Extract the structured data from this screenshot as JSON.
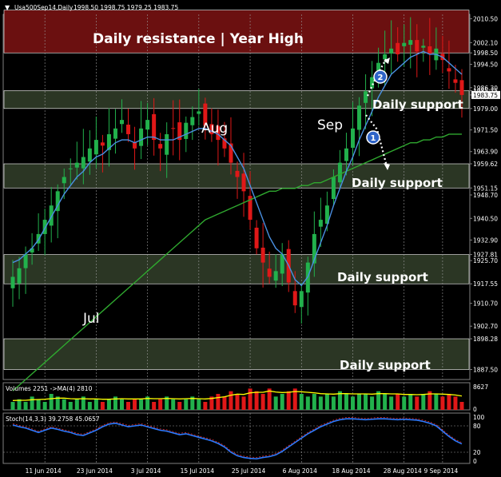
{
  "header": {
    "symbol": "Usa500Sep14,Daily",
    "ohlc": "1998.50 1998.75 1979.25 1983.75"
  },
  "colors": {
    "background": "#000000",
    "up_candle": "#22b14c",
    "down_candle": "#e01818",
    "ma_fast": "#4a90e2",
    "ma_slow": "#2fa82f",
    "resistance_zone": "#6b1010",
    "support_zone": "#33402a",
    "axis_text": "#ffffff",
    "stoch_line": "#2e7bff",
    "volume_ma": "#ffff00"
  },
  "annotations": {
    "resistance": "Daily resistance | Year High",
    "support_1": "Daily support",
    "support_2": "Daily support",
    "support_3": "Daily support",
    "support_4": "Daily support",
    "month_jul": "Jul",
    "month_aug": "Aug",
    "month_sep": "Sep",
    "marker_1": "1",
    "marker_2": "2"
  },
  "volume_panel": {
    "label": "Volumes 2251 ->MA(4) 2810",
    "max_label": "8627",
    "min_label": "0"
  },
  "stoch_panel": {
    "label": "Stoch(14,3,3) 39.2758 45.0657",
    "ticks": [
      "100",
      "80",
      "20",
      "0"
    ]
  },
  "chart_data": {
    "type": "candlestick",
    "y_axis_labels": [
      "2010.50",
      "2002.10",
      "1998.50",
      "1994.50",
      "1986.30",
      "1985.25",
      "1983.75",
      "1979.00",
      "1971.50",
      "1963.90",
      "1959.62",
      "1951.15",
      "1948.70",
      "1940.50",
      "1932.90",
      "1927.81",
      "1925.70",
      "1917.55",
      "1910.70",
      "1902.70",
      "1898.28",
      "1887.50"
    ],
    "ylim": [
      1884,
      2012
    ],
    "x_axis_labels": [
      "11 Jun 2014",
      "23 Jun 2014",
      "3 Jul 2014",
      "15 Jul 2014",
      "25 Jul 2014",
      "6 Aug 2014",
      "18 Aug 2014",
      "28 Aug 2014",
      "9 Sep 2014"
    ],
    "resistance_zone": [
      1998.5,
      2010.5
    ],
    "support_zones": [
      [
        1979.0,
        1985.25
      ],
      [
        1951.15,
        1959.62
      ],
      [
        1917.55,
        1927.81
      ],
      [
        1887.5,
        1898.28
      ]
    ],
    "close_series": [
      1920,
      1923,
      1928,
      1930,
      1935,
      1940,
      1945,
      1950,
      1955,
      1958,
      1960,
      1962,
      1965,
      1968,
      1966,
      1970,
      1972,
      1975,
      1970,
      1965,
      1972,
      1975,
      1968,
      1965,
      1970,
      1972,
      1968,
      1974,
      1976,
      1978,
      1973,
      1970,
      1968,
      1965,
      1960,
      1955,
      1950,
      1940,
      1930,
      1925,
      1920,
      1922,
      1928,
      1918,
      1910,
      1915,
      1925,
      1935,
      1940,
      1945,
      1955,
      1960,
      1965,
      1972,
      1980,
      1985,
      1990,
      1995,
      1998,
      2000,
      1998,
      2002,
      2003,
      1999,
      2001,
      1998,
      2000,
      1996,
      1992,
      1988,
      1983.75
    ],
    "ma_fast": [
      1925,
      1926,
      1928,
      1930,
      1933,
      1937,
      1941,
      1945,
      1949,
      1952,
      1955,
      1957,
      1960,
      1962,
      1963,
      1965,
      1967,
      1968,
      1968,
      1967,
      1968,
      1969,
      1969,
      1968,
      1968,
      1968,
      1969,
      1970,
      1971,
      1972,
      1972,
      1971,
      1970,
      1968,
      1966,
      1962,
      1958,
      1952,
      1946,
      1940,
      1934,
      1930,
      1928,
      1924,
      1919,
      1917,
      1920,
      1926,
      1932,
      1938,
      1945,
      1951,
      1957,
      1962,
      1968,
      1973,
      1978,
      1983,
      1987,
      1991,
      1993,
      1995,
      1997,
      1998,
      1999,
      1998,
      1998,
      1997,
      1995,
      1993,
      1991
    ],
    "ma_slow": [
      1880,
      1882,
      1884,
      1886,
      1888,
      1890,
      1892,
      1894,
      1896,
      1898,
      1900,
      1902,
      1904,
      1906,
      1908,
      1910,
      1912,
      1914,
      1916,
      1918,
      1920,
      1922,
      1924,
      1926,
      1928,
      1930,
      1932,
      1934,
      1936,
      1938,
      1940,
      1941,
      1942,
      1943,
      1944,
      1945,
      1946,
      1947,
      1948,
      1949,
      1950,
      1950,
      1951,
      1951,
      1951,
      1952,
      1952,
      1953,
      1953,
      1954,
      1955,
      1956,
      1957,
      1958,
      1959,
      1960,
      1961,
      1962,
      1963,
      1964,
      1965,
      1966,
      1967,
      1967,
      1968,
      1968,
      1969,
      1969,
      1970,
      1970,
      1970
    ],
    "volume_values": [
      3,
      4,
      3,
      5,
      4,
      3,
      6,
      5,
      4,
      3,
      4,
      5,
      3,
      4,
      3,
      4,
      5,
      4,
      3,
      4,
      4,
      5,
      3,
      4,
      5,
      4,
      3,
      4,
      5,
      4,
      3,
      5,
      6,
      5,
      7,
      6,
      5,
      8,
      7,
      6,
      8,
      5,
      6,
      7,
      8,
      6,
      5,
      6,
      5,
      6,
      5,
      7,
      6,
      5,
      6,
      6,
      5,
      7,
      6,
      5,
      6,
      5,
      6,
      5,
      6,
      7,
      6,
      5,
      6,
      5,
      3
    ],
    "volume_ma_values": [
      3.5,
      3.6,
      3.6,
      3.8,
      3.9,
      4,
      4.2,
      4.4,
      4.4,
      4.2,
      4.1,
      4.2,
      4.1,
      4.1,
      4,
      4,
      4.1,
      4.2,
      4.1,
      4.1,
      4.1,
      4.3,
      4.2,
      4.2,
      4.3,
      4.2,
      4.1,
      4.2,
      4.3,
      4.2,
      4.1,
      4.3,
      4.6,
      4.9,
      5.5,
      5.9,
      5.8,
      6.4,
      6.6,
      6.6,
      7.1,
      6.7,
      6.5,
      6.6,
      6.9,
      6.8,
      6.6,
      6.4,
      6.1,
      6,
      5.9,
      6.1,
      6.1,
      6,
      6,
      6,
      5.9,
      6.1,
      6.1,
      6,
      6,
      5.8,
      5.8,
      5.7,
      5.8,
      6,
      6,
      5.9,
      5.8,
      5.6,
      5.2
    ],
    "stoch_values": [
      82,
      78,
      75,
      70,
      65,
      70,
      75,
      72,
      68,
      65,
      60,
      58,
      64,
      70,
      78,
      84,
      86,
      82,
      78,
      80,
      82,
      78,
      74,
      70,
      68,
      64,
      60,
      62,
      58,
      54,
      50,
      46,
      40,
      32,
      20,
      12,
      8,
      6,
      5,
      8,
      10,
      14,
      22,
      32,
      42,
      52,
      62,
      70,
      78,
      84,
      90,
      94,
      96,
      96,
      95,
      94,
      95,
      96,
      96,
      95,
      94,
      95,
      94,
      93,
      90,
      86,
      80,
      68,
      56,
      46,
      39
    ]
  }
}
